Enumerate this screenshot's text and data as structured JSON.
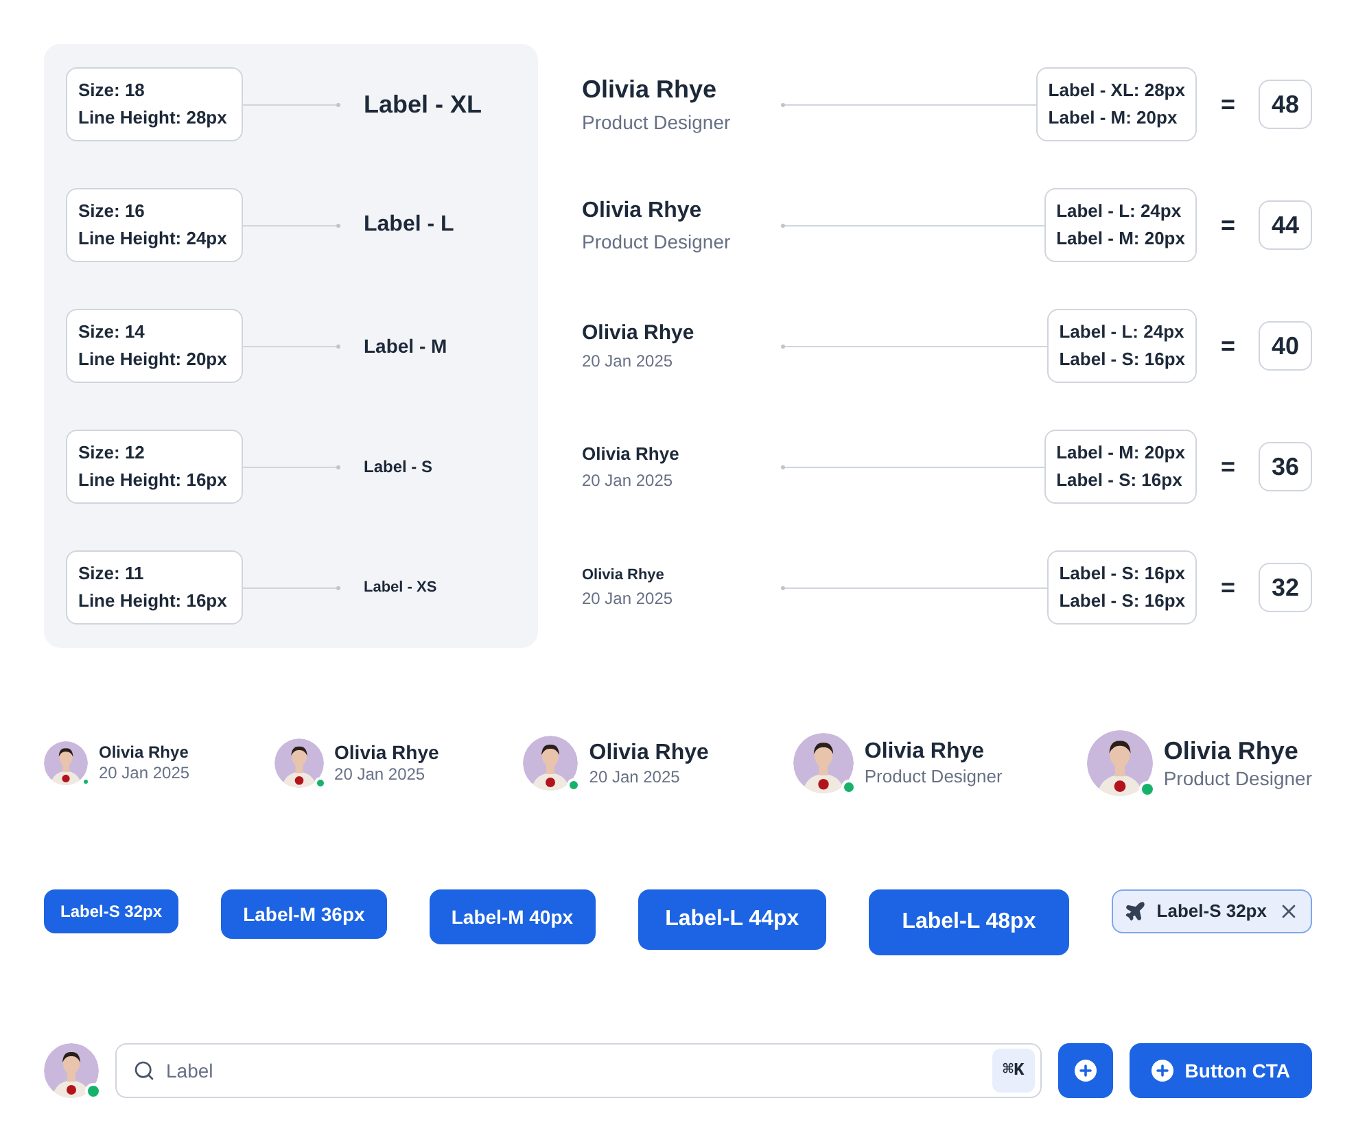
{
  "type_scale": [
    {
      "size": "Size: 18",
      "line_height": "Line Height: 28px",
      "label": "Label - XL"
    },
    {
      "size": "Size: 16",
      "line_height": "Line Height: 24px",
      "label": "Label - L"
    },
    {
      "size": "Size: 14",
      "line_height": "Line Height: 20px",
      "label": "Label - M"
    },
    {
      "size": "Size: 12",
      "line_height": "Line Height: 16px",
      "label": "Label - S"
    },
    {
      "size": "Size: 11",
      "line_height": "Line Height: 16px",
      "label": "Label - XS"
    }
  ],
  "name_blocks": [
    {
      "name": "Olivia Rhye",
      "subtitle": "Product Designer",
      "specs": [
        "Label - XL: 28px",
        "Label - M: 20px"
      ],
      "operator": "=",
      "total": "48"
    },
    {
      "name": "Olivia Rhye",
      "subtitle": "Product Designer",
      "specs": [
        "Label - L: 24px",
        "Label - M: 20px"
      ],
      "operator": "=",
      "total": "44"
    },
    {
      "name": "Olivia Rhye",
      "subtitle": "20 Jan 2025",
      "specs": [
        "Label - L: 24px",
        "Label - S: 16px"
      ],
      "operator": "=",
      "total": "40"
    },
    {
      "name": "Olivia Rhye",
      "subtitle": "20 Jan 2025",
      "specs": [
        "Label - M: 20px",
        "Label - S: 16px"
      ],
      "operator": "=",
      "total": "36"
    },
    {
      "name": "Olivia Rhye",
      "subtitle": "20 Jan 2025",
      "specs": [
        "Label - S: 16px",
        "Label - S: 16px"
      ],
      "operator": "=",
      "total": "32"
    }
  ],
  "profiles": [
    {
      "name": "Olivia Rhye",
      "subtitle": "20 Jan 2025",
      "online": true
    },
    {
      "name": "Olivia Rhye",
      "subtitle": "20 Jan 2025",
      "online": true
    },
    {
      "name": "Olivia Rhye",
      "subtitle": "20 Jan 2025",
      "online": true
    },
    {
      "name": "Olivia Rhye",
      "subtitle": "Product Designer",
      "online": true
    },
    {
      "name": "Olivia Rhye",
      "subtitle": "Product Designer",
      "online": true
    }
  ],
  "buttons": [
    {
      "label": "Label-S 32px"
    },
    {
      "label": "Label-M 36px"
    },
    {
      "label": "Label-M 40px"
    },
    {
      "label": "Label-L 44px"
    },
    {
      "label": "Label-L 48px"
    }
  ],
  "chip": {
    "label": "Label-S 32px"
  },
  "toolbar": {
    "online": true,
    "search": {
      "placeholder": "Label",
      "shortcut": "⌘K"
    },
    "cta": {
      "label": "Button CTA"
    }
  }
}
